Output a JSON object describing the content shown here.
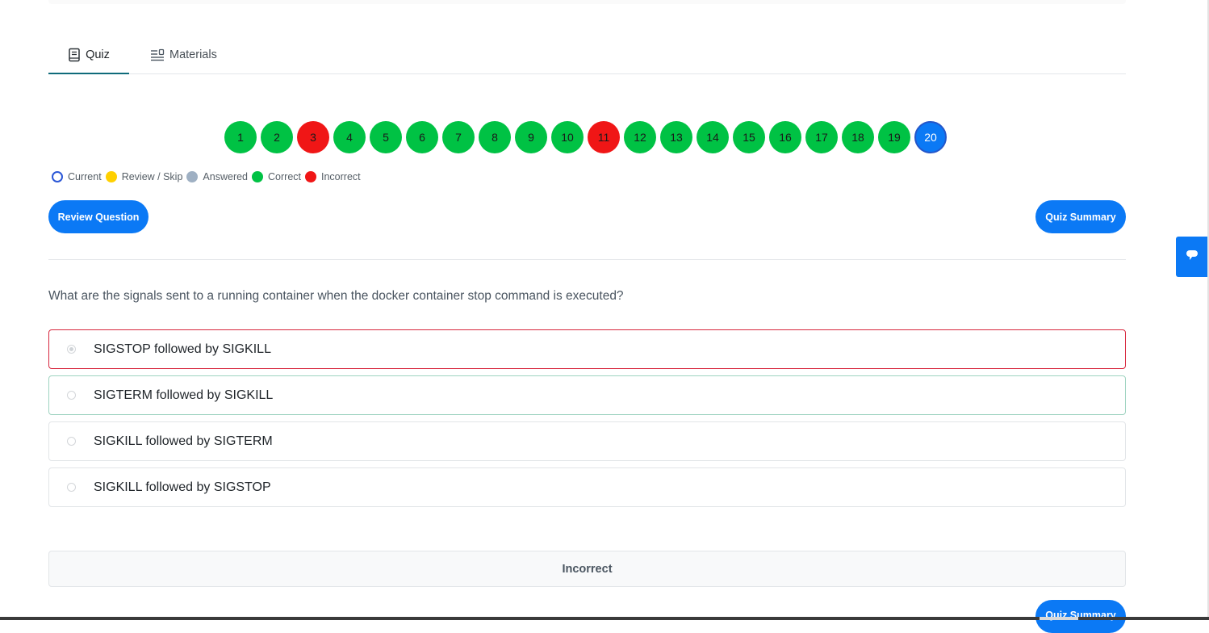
{
  "tabs": [
    {
      "label": "Quiz",
      "icon": "book-icon",
      "active": true
    },
    {
      "label": "Materials",
      "icon": "list-icon",
      "active": false
    }
  ],
  "pager": [
    {
      "label": "1",
      "status": "correct"
    },
    {
      "label": "2",
      "status": "correct"
    },
    {
      "label": "3",
      "status": "incorrect"
    },
    {
      "label": "4",
      "status": "correct"
    },
    {
      "label": "5",
      "status": "correct"
    },
    {
      "label": "6",
      "status": "correct"
    },
    {
      "label": "7",
      "status": "correct"
    },
    {
      "label": "8",
      "status": "correct"
    },
    {
      "label": "9",
      "status": "correct"
    },
    {
      "label": "10",
      "status": "correct"
    },
    {
      "label": "11",
      "status": "incorrect"
    },
    {
      "label": "12",
      "status": "correct"
    },
    {
      "label": "13",
      "status": "correct"
    },
    {
      "label": "14",
      "status": "correct"
    },
    {
      "label": "15",
      "status": "correct"
    },
    {
      "label": "16",
      "status": "correct"
    },
    {
      "label": "17",
      "status": "correct"
    },
    {
      "label": "18",
      "status": "correct"
    },
    {
      "label": "19",
      "status": "correct"
    },
    {
      "label": "20",
      "status": "current"
    }
  ],
  "legend": {
    "current": "Current",
    "review": "Review / Skip",
    "answered": "Answered",
    "correct": "Correct",
    "incorrect": "Incorrect"
  },
  "buttons": {
    "review_question": "Review Question",
    "quiz_summary": "Quiz Summary",
    "quiz_summary_bottom": "Quiz Summary"
  },
  "question": {
    "text": "What are the signals sent to a running container when the docker container stop command is executed?",
    "options": [
      {
        "label": "SIGSTOP followed by SIGKILL",
        "selected": true,
        "state": "wrong"
      },
      {
        "label": "SIGTERM followed by SIGKILL",
        "selected": false,
        "state": "right"
      },
      {
        "label": "SIGKILL followed by SIGTERM",
        "selected": false,
        "state": "neutral"
      },
      {
        "label": "SIGKILL followed by SIGSTOP",
        "selected": false,
        "state": "neutral"
      }
    ]
  },
  "result": "Incorrect",
  "colors": {
    "accent": "#0b79f5",
    "correct": "#00c244",
    "incorrect": "#f01616",
    "review": "#ffd000",
    "answered": "#9fb0c3"
  }
}
